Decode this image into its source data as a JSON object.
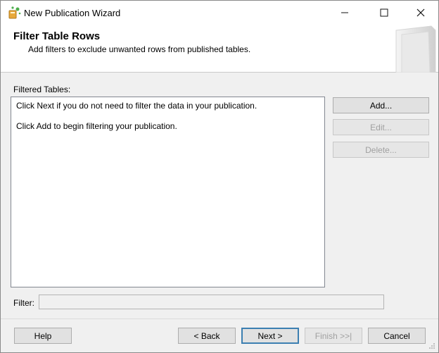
{
  "window": {
    "title": "New Publication Wizard",
    "controls": {
      "minimize": "—",
      "maximize": "☐",
      "close": "✕"
    }
  },
  "header": {
    "title": "Filter Table Rows",
    "subtitle": "Add filters to exclude unwanted rows from published tables."
  },
  "filtered_tables": {
    "label": "Filtered Tables:",
    "lines": [
      "Click Next if you do not need to filter the data in your publication.",
      "Click Add to begin filtering your publication."
    ]
  },
  "side_buttons": {
    "add": "Add...",
    "edit": "Edit...",
    "delete": "Delete..."
  },
  "filter": {
    "label": "Filter:",
    "value": ""
  },
  "footer": {
    "help": "Help",
    "back": "< Back",
    "next": "Next >",
    "finish": "Finish >>|",
    "cancel": "Cancel"
  },
  "colors": {
    "accent": "#3c7fb1",
    "disabled_text": "#a0a0a0"
  }
}
